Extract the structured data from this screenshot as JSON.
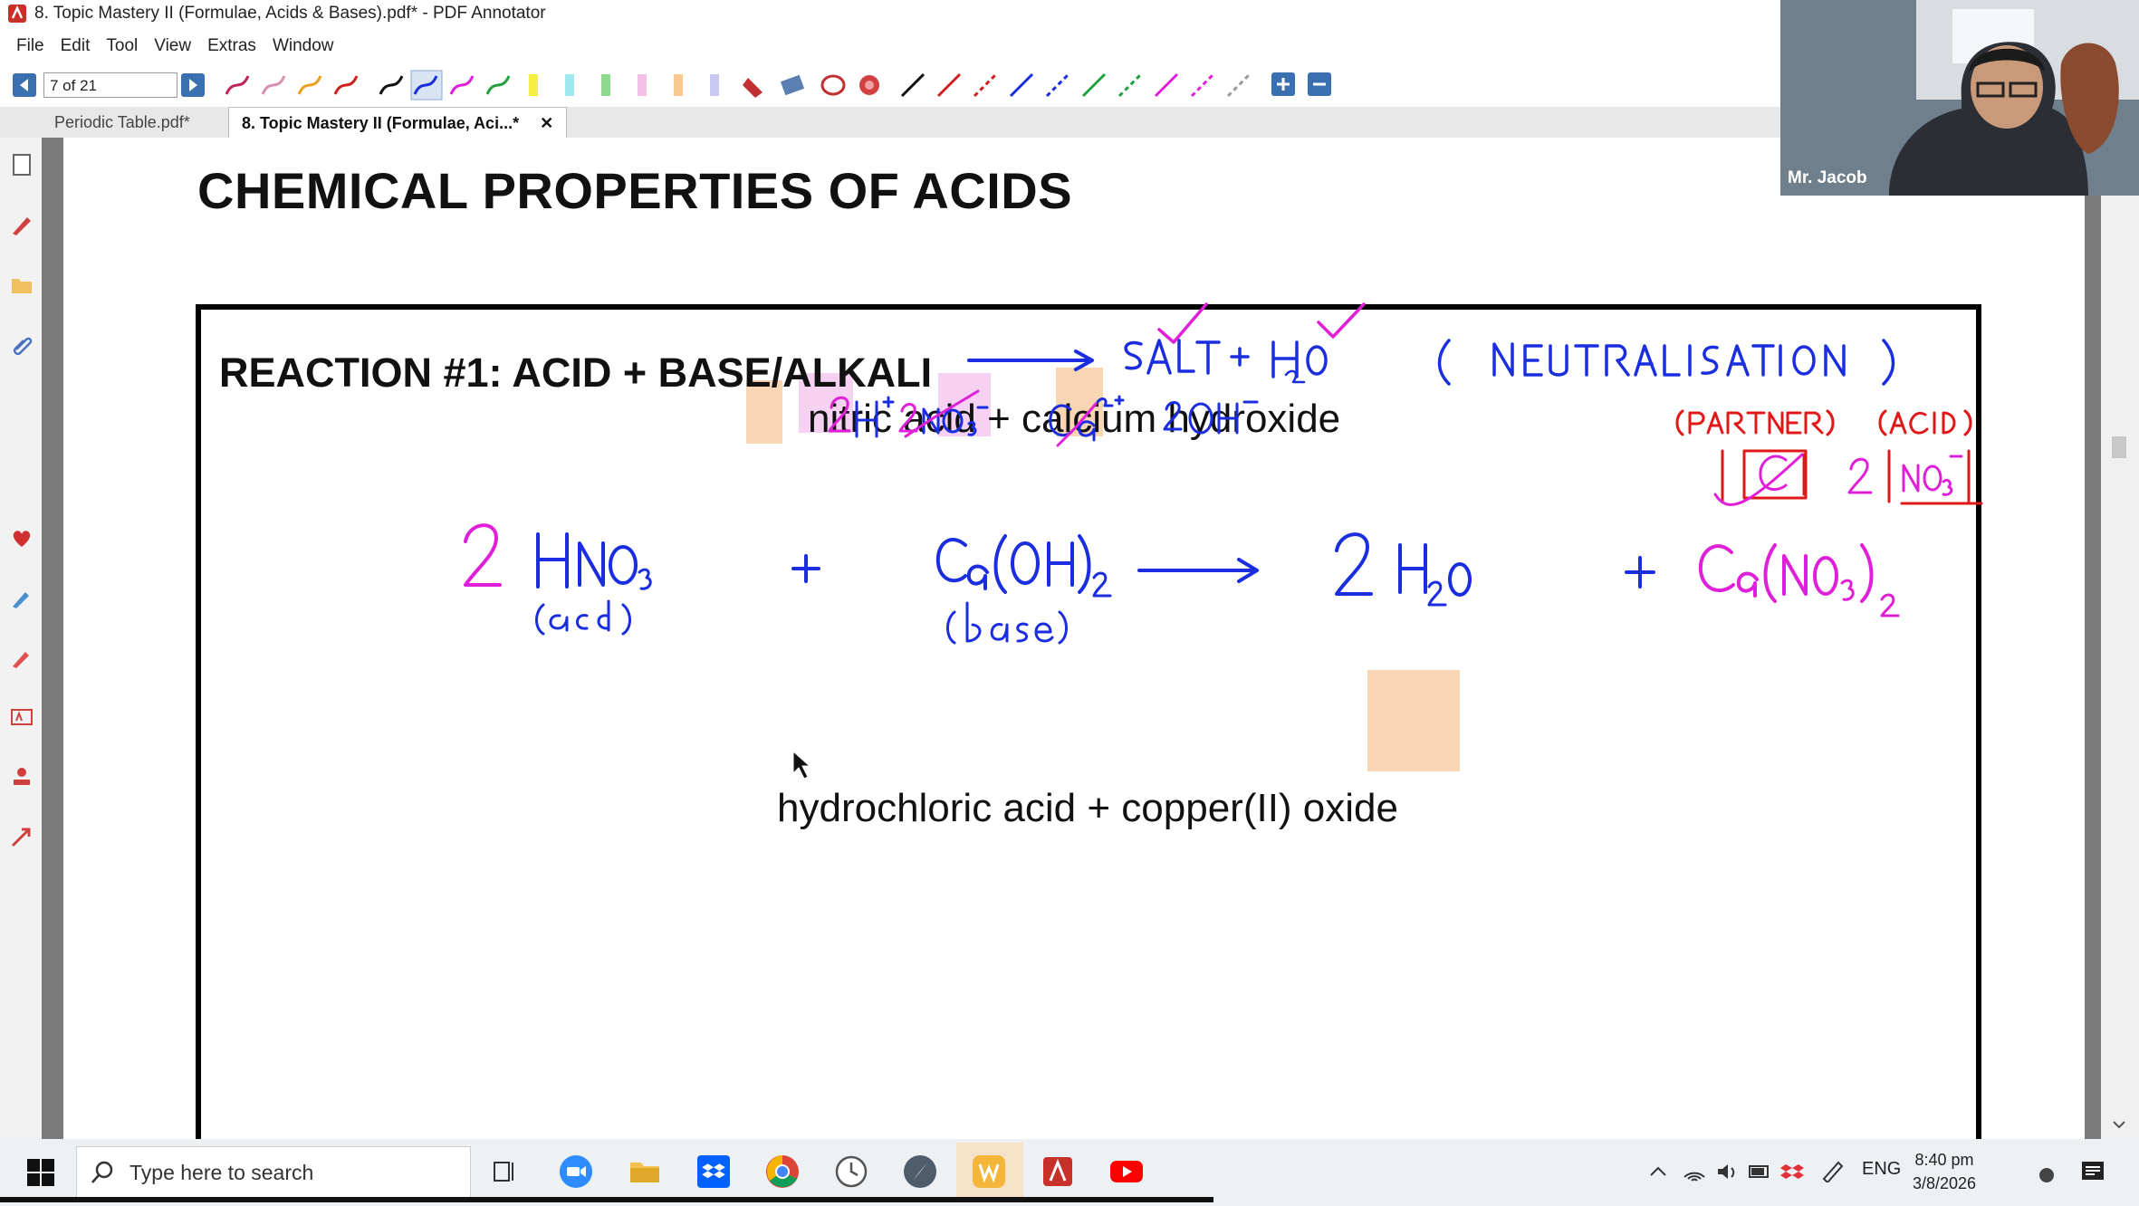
{
  "window": {
    "title": "8. Topic Mastery II (Formulae, Acids & Bases).pdf* - PDF Annotator"
  },
  "menu": [
    "File",
    "Edit",
    "Tool",
    "View",
    "Extras",
    "Window"
  ],
  "toolbar": {
    "page_indicator": "7 of 21"
  },
  "tabs": [
    {
      "label": "Periodic Table.pdf*"
    },
    {
      "label": "8. Topic Mastery II (Formulae, Aci...*"
    }
  ],
  "page": {
    "heading": "CHEMICAL PROPERTIES OF ACIDS",
    "reaction_title": "REACTION #1: ACID + BASE/ALKALI",
    "example1": "nitric acid + calcium hydroxide",
    "example2": "hydrochloric acid + copper(II) oxide"
  },
  "webcam": {
    "name": "Mr. Jacob"
  },
  "taskbar": {
    "search_placeholder": "Type here to search",
    "lang": "ENG",
    "time": "8:40 pm",
    "date": "3/8/2026"
  },
  "colors": {
    "ink_blue": "#1a2ee0",
    "ink_magenta": "#e020d8",
    "ink_red": "#e01818",
    "highlight_orange": "#f7cfa6",
    "highlight_pink": "#f5c9f0",
    "nav_blue": "#3a6fb0"
  }
}
